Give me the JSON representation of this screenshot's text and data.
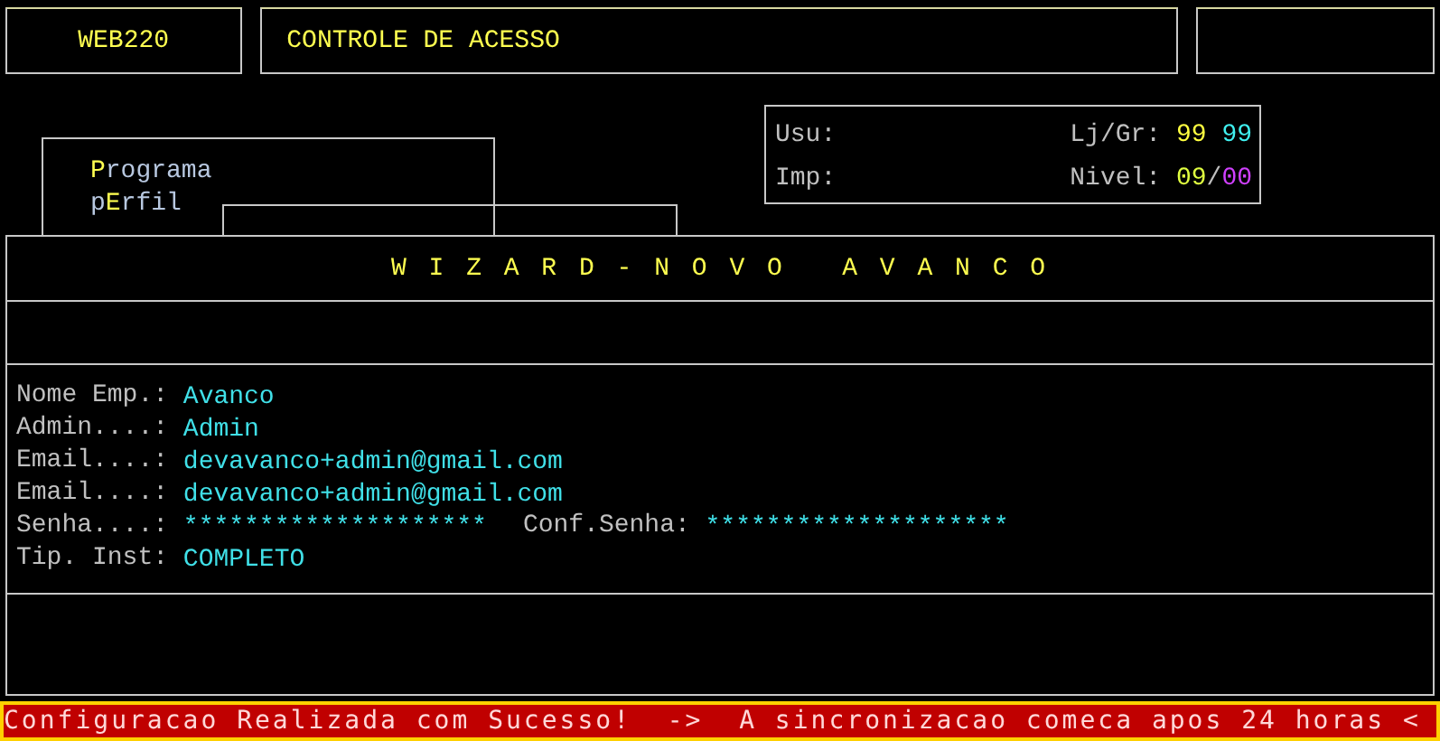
{
  "header": {
    "code": "WEB220",
    "title": "CONTROLE DE ACESSO"
  },
  "menu": [
    {
      "key": "P",
      "after": "rograma"
    },
    {
      "before": "p",
      "key": "E",
      "after": "rfil"
    }
  ],
  "info": {
    "user_label": "Usu:",
    "printer_label": "Imp:",
    "store_label": "Lj/Gr:",
    "store": "99",
    "group": "99",
    "level_label": "Nivel:",
    "level_a": "09",
    "separator": "/",
    "level_b": "00"
  },
  "wizard": {
    "title": "W I Z A R D - N O V O   A V A N C O",
    "fields": [
      {
        "label": "Nome Emp.:",
        "value": "Avanco"
      },
      {
        "label": "Admin....:",
        "value": "Admin"
      },
      {
        "label": "Email....:",
        "value": "devavanco+admin@gmail.com"
      },
      {
        "label": "Email....:",
        "value": "devavanco+admin@gmail.com"
      },
      {
        "label": "Senha....:",
        "value": "********************",
        "extra_label": "Conf.Senha:",
        "extra_value": "********************"
      },
      {
        "label": "Tip. Inst:",
        "value": "COMPLETO"
      }
    ]
  },
  "status_bar": "Configuracao Realizada com Sucesso!  ->  A sincronizacao comeca apos 24 horas <"
}
